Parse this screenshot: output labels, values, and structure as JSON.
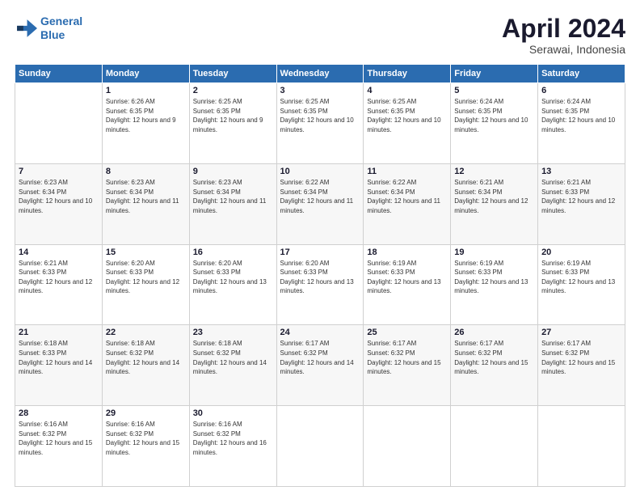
{
  "logo": {
    "line1": "General",
    "line2": "Blue"
  },
  "title": "April 2024",
  "subtitle": "Serawai, Indonesia",
  "header": {
    "days": [
      "Sunday",
      "Monday",
      "Tuesday",
      "Wednesday",
      "Thursday",
      "Friday",
      "Saturday"
    ]
  },
  "weeks": [
    [
      {
        "day": "",
        "sunrise": "",
        "sunset": "",
        "daylight": ""
      },
      {
        "day": "1",
        "sunrise": "Sunrise: 6:26 AM",
        "sunset": "Sunset: 6:35 PM",
        "daylight": "Daylight: 12 hours and 9 minutes."
      },
      {
        "day": "2",
        "sunrise": "Sunrise: 6:25 AM",
        "sunset": "Sunset: 6:35 PM",
        "daylight": "Daylight: 12 hours and 9 minutes."
      },
      {
        "day": "3",
        "sunrise": "Sunrise: 6:25 AM",
        "sunset": "Sunset: 6:35 PM",
        "daylight": "Daylight: 12 hours and 10 minutes."
      },
      {
        "day": "4",
        "sunrise": "Sunrise: 6:25 AM",
        "sunset": "Sunset: 6:35 PM",
        "daylight": "Daylight: 12 hours and 10 minutes."
      },
      {
        "day": "5",
        "sunrise": "Sunrise: 6:24 AM",
        "sunset": "Sunset: 6:35 PM",
        "daylight": "Daylight: 12 hours and 10 minutes."
      },
      {
        "day": "6",
        "sunrise": "Sunrise: 6:24 AM",
        "sunset": "Sunset: 6:35 PM",
        "daylight": "Daylight: 12 hours and 10 minutes."
      }
    ],
    [
      {
        "day": "7",
        "sunrise": "Sunrise: 6:23 AM",
        "sunset": "Sunset: 6:34 PM",
        "daylight": "Daylight: 12 hours and 10 minutes."
      },
      {
        "day": "8",
        "sunrise": "Sunrise: 6:23 AM",
        "sunset": "Sunset: 6:34 PM",
        "daylight": "Daylight: 12 hours and 11 minutes."
      },
      {
        "day": "9",
        "sunrise": "Sunrise: 6:23 AM",
        "sunset": "Sunset: 6:34 PM",
        "daylight": "Daylight: 12 hours and 11 minutes."
      },
      {
        "day": "10",
        "sunrise": "Sunrise: 6:22 AM",
        "sunset": "Sunset: 6:34 PM",
        "daylight": "Daylight: 12 hours and 11 minutes."
      },
      {
        "day": "11",
        "sunrise": "Sunrise: 6:22 AM",
        "sunset": "Sunset: 6:34 PM",
        "daylight": "Daylight: 12 hours and 11 minutes."
      },
      {
        "day": "12",
        "sunrise": "Sunrise: 6:21 AM",
        "sunset": "Sunset: 6:34 PM",
        "daylight": "Daylight: 12 hours and 12 minutes."
      },
      {
        "day": "13",
        "sunrise": "Sunrise: 6:21 AM",
        "sunset": "Sunset: 6:33 PM",
        "daylight": "Daylight: 12 hours and 12 minutes."
      }
    ],
    [
      {
        "day": "14",
        "sunrise": "Sunrise: 6:21 AM",
        "sunset": "Sunset: 6:33 PM",
        "daylight": "Daylight: 12 hours and 12 minutes."
      },
      {
        "day": "15",
        "sunrise": "Sunrise: 6:20 AM",
        "sunset": "Sunset: 6:33 PM",
        "daylight": "Daylight: 12 hours and 12 minutes."
      },
      {
        "day": "16",
        "sunrise": "Sunrise: 6:20 AM",
        "sunset": "Sunset: 6:33 PM",
        "daylight": "Daylight: 12 hours and 13 minutes."
      },
      {
        "day": "17",
        "sunrise": "Sunrise: 6:20 AM",
        "sunset": "Sunset: 6:33 PM",
        "daylight": "Daylight: 12 hours and 13 minutes."
      },
      {
        "day": "18",
        "sunrise": "Sunrise: 6:19 AM",
        "sunset": "Sunset: 6:33 PM",
        "daylight": "Daylight: 12 hours and 13 minutes."
      },
      {
        "day": "19",
        "sunrise": "Sunrise: 6:19 AM",
        "sunset": "Sunset: 6:33 PM",
        "daylight": "Daylight: 12 hours and 13 minutes."
      },
      {
        "day": "20",
        "sunrise": "Sunrise: 6:19 AM",
        "sunset": "Sunset: 6:33 PM",
        "daylight": "Daylight: 12 hours and 13 minutes."
      }
    ],
    [
      {
        "day": "21",
        "sunrise": "Sunrise: 6:18 AM",
        "sunset": "Sunset: 6:33 PM",
        "daylight": "Daylight: 12 hours and 14 minutes."
      },
      {
        "day": "22",
        "sunrise": "Sunrise: 6:18 AM",
        "sunset": "Sunset: 6:32 PM",
        "daylight": "Daylight: 12 hours and 14 minutes."
      },
      {
        "day": "23",
        "sunrise": "Sunrise: 6:18 AM",
        "sunset": "Sunset: 6:32 PM",
        "daylight": "Daylight: 12 hours and 14 minutes."
      },
      {
        "day": "24",
        "sunrise": "Sunrise: 6:17 AM",
        "sunset": "Sunset: 6:32 PM",
        "daylight": "Daylight: 12 hours and 14 minutes."
      },
      {
        "day": "25",
        "sunrise": "Sunrise: 6:17 AM",
        "sunset": "Sunset: 6:32 PM",
        "daylight": "Daylight: 12 hours and 15 minutes."
      },
      {
        "day": "26",
        "sunrise": "Sunrise: 6:17 AM",
        "sunset": "Sunset: 6:32 PM",
        "daylight": "Daylight: 12 hours and 15 minutes."
      },
      {
        "day": "27",
        "sunrise": "Sunrise: 6:17 AM",
        "sunset": "Sunset: 6:32 PM",
        "daylight": "Daylight: 12 hours and 15 minutes."
      }
    ],
    [
      {
        "day": "28",
        "sunrise": "Sunrise: 6:16 AM",
        "sunset": "Sunset: 6:32 PM",
        "daylight": "Daylight: 12 hours and 15 minutes."
      },
      {
        "day": "29",
        "sunrise": "Sunrise: 6:16 AM",
        "sunset": "Sunset: 6:32 PM",
        "daylight": "Daylight: 12 hours and 15 minutes."
      },
      {
        "day": "30",
        "sunrise": "Sunrise: 6:16 AM",
        "sunset": "Sunset: 6:32 PM",
        "daylight": "Daylight: 12 hours and 16 minutes."
      },
      {
        "day": "",
        "sunrise": "",
        "sunset": "",
        "daylight": ""
      },
      {
        "day": "",
        "sunrise": "",
        "sunset": "",
        "daylight": ""
      },
      {
        "day": "",
        "sunrise": "",
        "sunset": "",
        "daylight": ""
      },
      {
        "day": "",
        "sunrise": "",
        "sunset": "",
        "daylight": ""
      }
    ]
  ]
}
